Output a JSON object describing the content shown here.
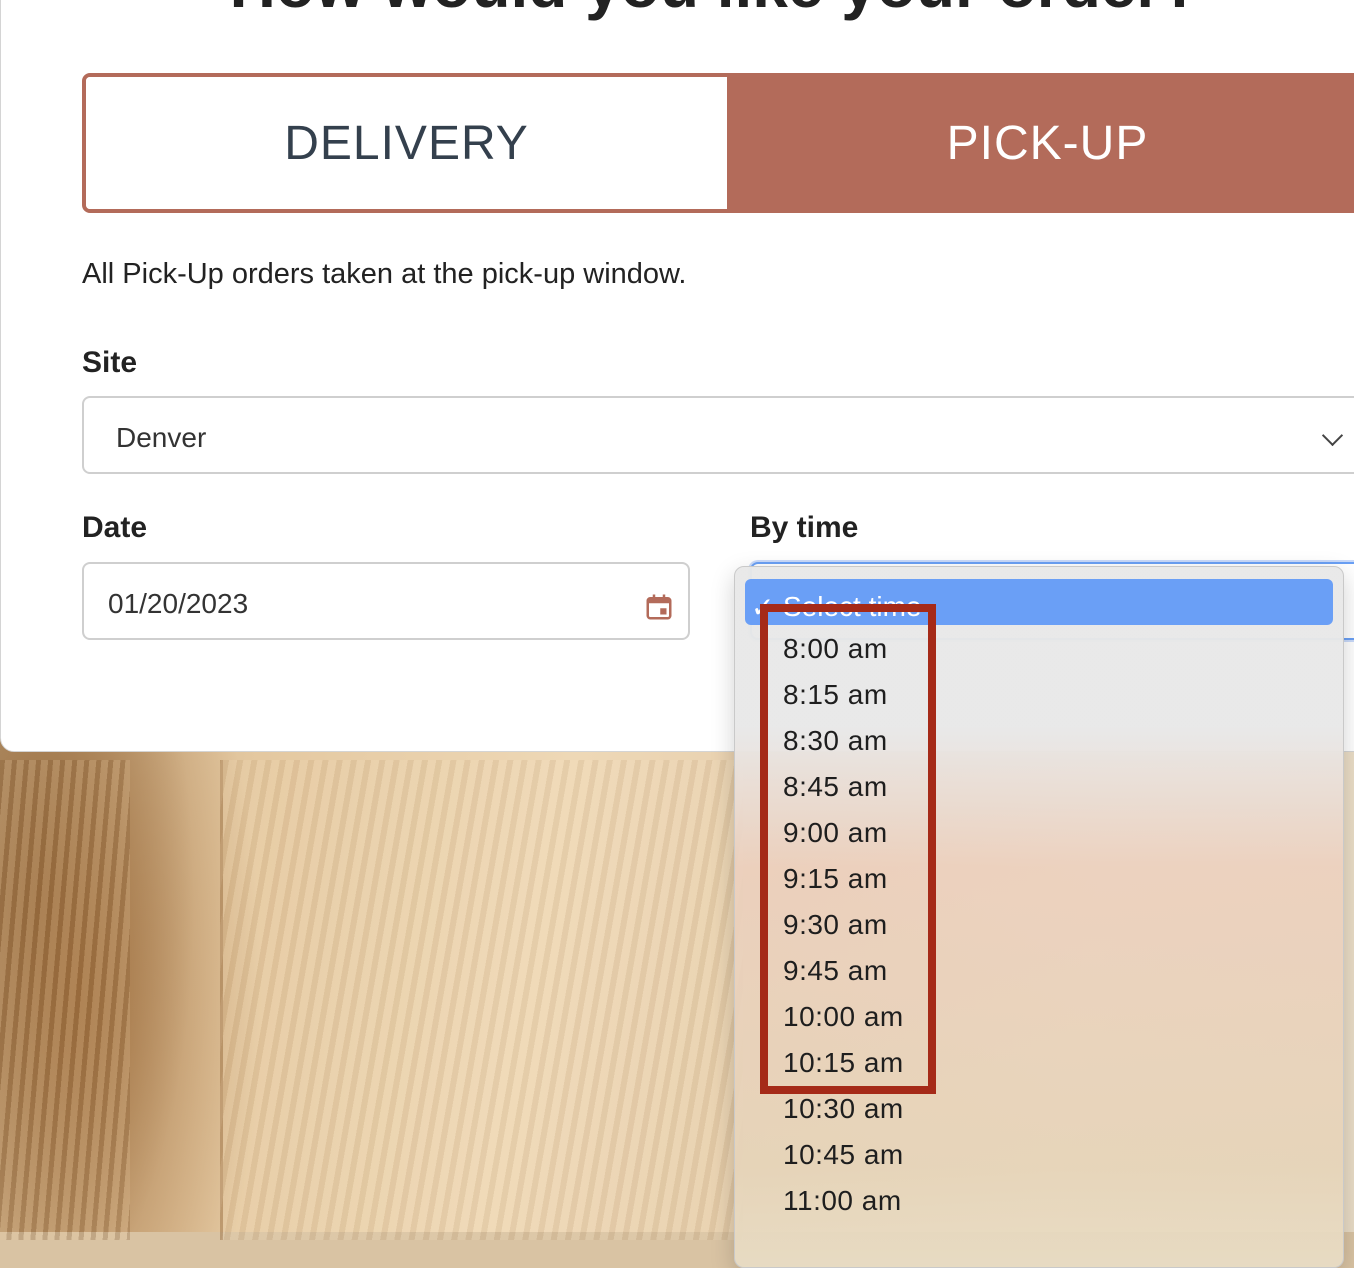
{
  "heading": "How would you like your order?",
  "tabs": {
    "delivery": "DELIVERY",
    "pickup": "PICK-UP",
    "active": "PICK-UP"
  },
  "info_text": "All Pick-Up orders taken at the pick-up window.",
  "site": {
    "label": "Site",
    "value": "Denver"
  },
  "date": {
    "label": "Date",
    "value": "01/20/2023"
  },
  "time": {
    "label": "By time",
    "selected": "Select time",
    "options": [
      "8:00 am",
      "8:15 am",
      "8:30 am",
      "8:45 am",
      "9:00 am",
      "9:15 am",
      "9:30 am",
      "9:45 am",
      "10:00 am",
      "10:15 am",
      "10:30 am",
      "10:45 am",
      "11:00 am"
    ]
  },
  "colors": {
    "accent": "#b36b5a",
    "highlight_box": "#a52a18",
    "selected_option": "#6a9ff6"
  },
  "icons": {
    "date_picker": "calendar-icon",
    "site_dropdown": "chevron-down-icon",
    "time_selected": "checkmark-icon"
  }
}
